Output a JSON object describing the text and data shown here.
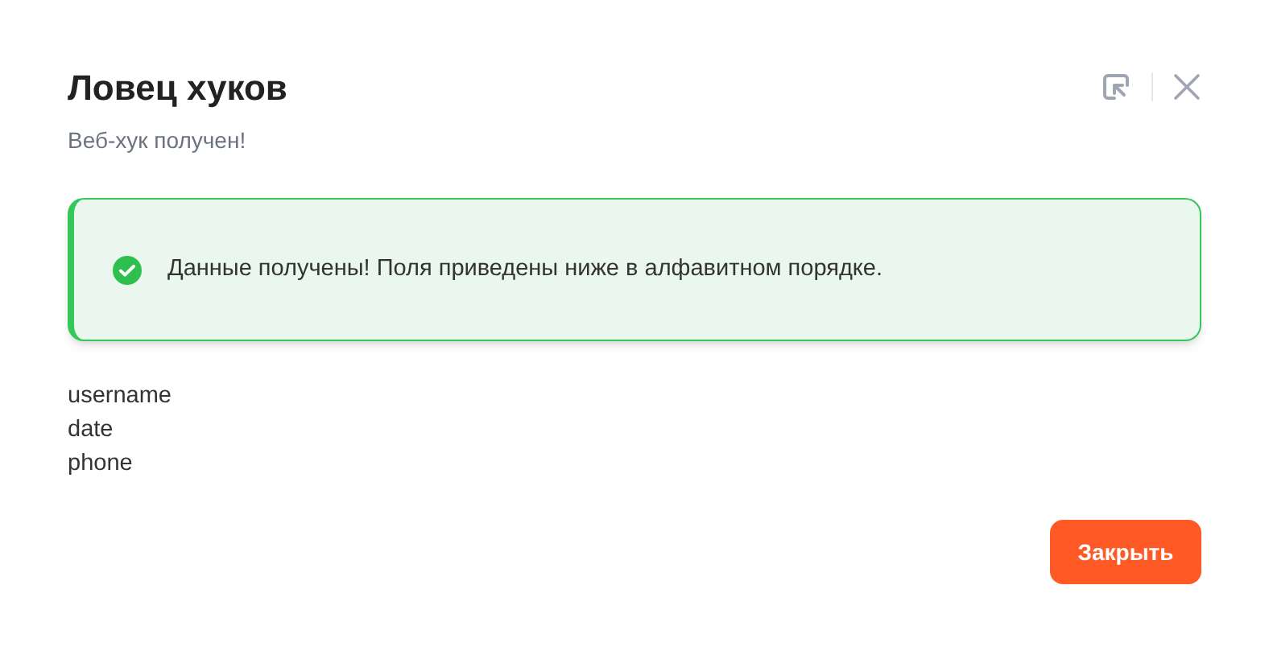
{
  "dialog": {
    "title": "Ловец хуков",
    "subtitle": "Веб-хук получен!"
  },
  "alert": {
    "kind": "success",
    "message": "Данные получены! Поля приведены ниже в алфавитном порядке."
  },
  "fields": [
    "username",
    "date",
    "phone"
  ],
  "buttons": [
    {
      "label": "Закрыть"
    }
  ]
}
